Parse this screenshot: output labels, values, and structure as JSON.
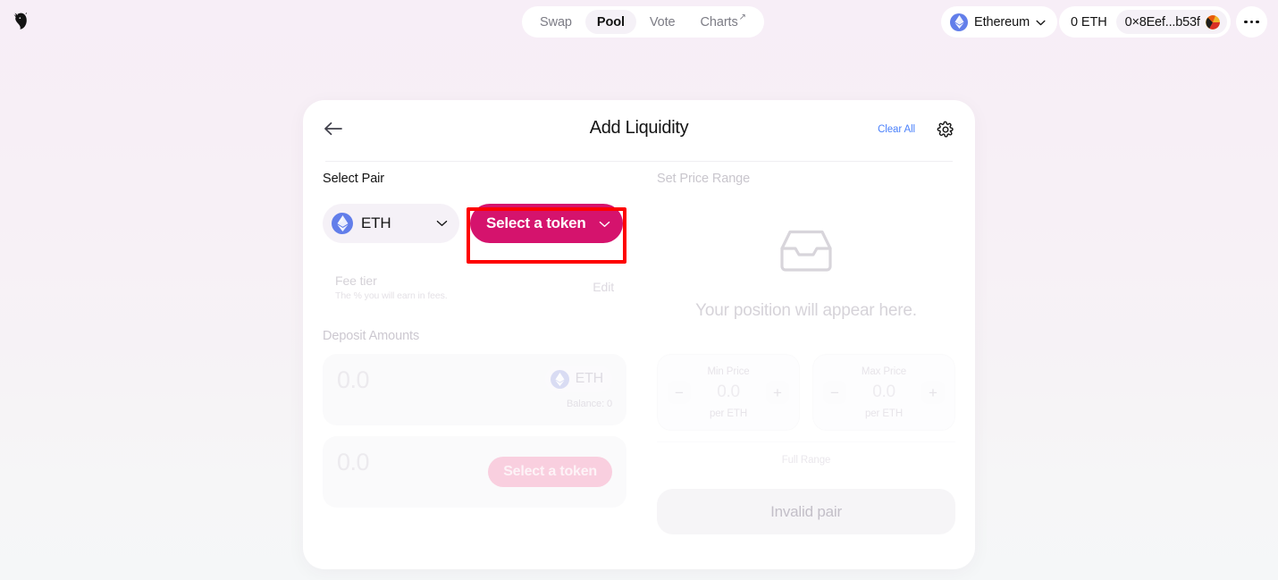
{
  "brand": {
    "logo_icon": "unicorn-logo"
  },
  "nav": {
    "items": [
      {
        "label": "Swap",
        "active": false,
        "external": false
      },
      {
        "label": "Pool",
        "active": true,
        "external": false
      },
      {
        "label": "Vote",
        "active": false,
        "external": false
      },
      {
        "label": "Charts",
        "active": false,
        "external": true
      }
    ],
    "external_glyph": "↗"
  },
  "wallet": {
    "chain_label": "Ethereum",
    "chain_icon": "ethereum-logo-icon",
    "chain_chevron_icon": "chevron-down-icon",
    "eth_balance": "0 ETH",
    "address": "0×8Eef...b53f",
    "avatar_icon": "wallet-avatar",
    "more_icon": "more-horizontal-icon"
  },
  "card": {
    "back_icon": "arrow-left-icon",
    "title": "Add Liquidity",
    "clear_all_label": "Clear All",
    "settings_icon": "gear-icon"
  },
  "select_pair": {
    "section_label": "Select Pair",
    "token_a": {
      "symbol": "ETH",
      "icon": "ethereum-logo-icon",
      "chevron_icon": "chevron-down-icon"
    },
    "token_b": {
      "label": "Select a token",
      "chevron_icon": "chevron-down-icon",
      "highlighted": true
    }
  },
  "fee_tier": {
    "title": "Fee tier",
    "subtitle": "The % you will earn in fees.",
    "edit_label": "Edit"
  },
  "deposit": {
    "section_label": "Deposit Amounts",
    "rows": [
      {
        "amount": "0.0",
        "token_symbol": "ETH",
        "token_icon": "ethereum-logo-icon",
        "balance": "Balance: 0",
        "has_token": true
      },
      {
        "amount": "0.0",
        "select_label": "Select a token",
        "has_token": false
      }
    ]
  },
  "price_range": {
    "section_label": "Set Price Range",
    "empty_icon": "inbox-tray-icon",
    "empty_text": "Your position will appear here.",
    "min": {
      "label": "Min Price",
      "value": "0.0",
      "unit": "per ETH",
      "decrement_glyph": "−",
      "increment_glyph": "+"
    },
    "max": {
      "label": "Max Price",
      "value": "0.0",
      "unit": "per ETH",
      "decrement_glyph": "−",
      "increment_glyph": "+"
    },
    "full_range_label": "Full Range"
  },
  "submit": {
    "label": "Invalid pair",
    "enabled": false
  },
  "colors": {
    "accent_pink": "#d5136d",
    "accent_pink_faded": "#f9cfdf",
    "link_blue": "#4c82fb",
    "ethereum_blue": "#627eea",
    "highlight_red": "#fe0000",
    "text_primary": "#131313"
  }
}
